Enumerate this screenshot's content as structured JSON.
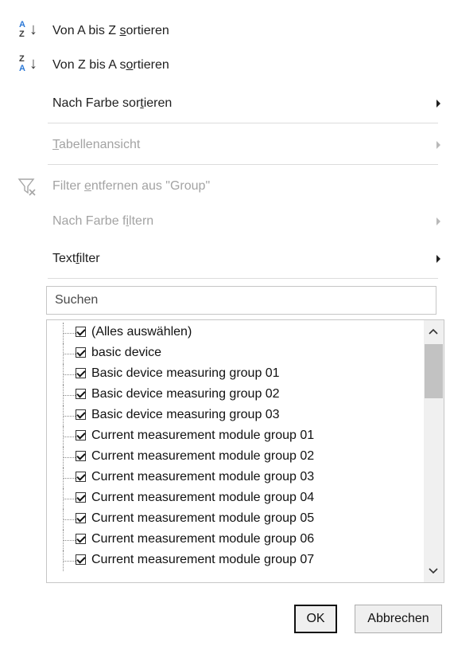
{
  "menu": {
    "sort_az": {
      "pre": "Von A bis Z ",
      "ul": "s",
      "post": "ortieren"
    },
    "sort_za": {
      "pre": "Von Z bis A s",
      "ul": "o",
      "post": "rtieren"
    },
    "sort_color": {
      "pre": "Nach Farbe sor",
      "ul": "t",
      "post": "ieren"
    },
    "table_view": {
      "pre": "",
      "ul": "T",
      "post": "abellenansicht"
    },
    "remove_filter": {
      "pre": "Filter ",
      "ul": "e",
      "post": "ntfernen aus \"Group\""
    },
    "filter_color": {
      "pre": "Nach Farbe f",
      "ul": "i",
      "post": "ltern"
    },
    "text_filter": {
      "pre": "Text",
      "ul": "f",
      "post": "ilter"
    }
  },
  "search": {
    "placeholder": "Suchen"
  },
  "list": {
    "items": [
      "(Alles auswählen)",
      "basic device",
      "Basic device measuring group 01",
      "Basic device measuring group 02",
      "Basic device measuring group 03",
      "Current measurement module group 01",
      "Current measurement module group 02",
      "Current measurement module group 03",
      "Current measurement module group 04",
      "Current measurement module group 05",
      "Current measurement module group 06",
      "Current measurement module group 07"
    ]
  },
  "buttons": {
    "ok": "OK",
    "cancel": "Abbrechen"
  },
  "colors": {
    "accent_blue": "#2b78d6",
    "disabled_text": "#a3a3a3"
  },
  "icons": [
    "sort-az-icon",
    "sort-za-icon",
    "clear-filter-icon",
    "submenu-arrow-icon",
    "checkbox-checked-icon",
    "scroll-up-icon",
    "scroll-down-icon"
  ]
}
